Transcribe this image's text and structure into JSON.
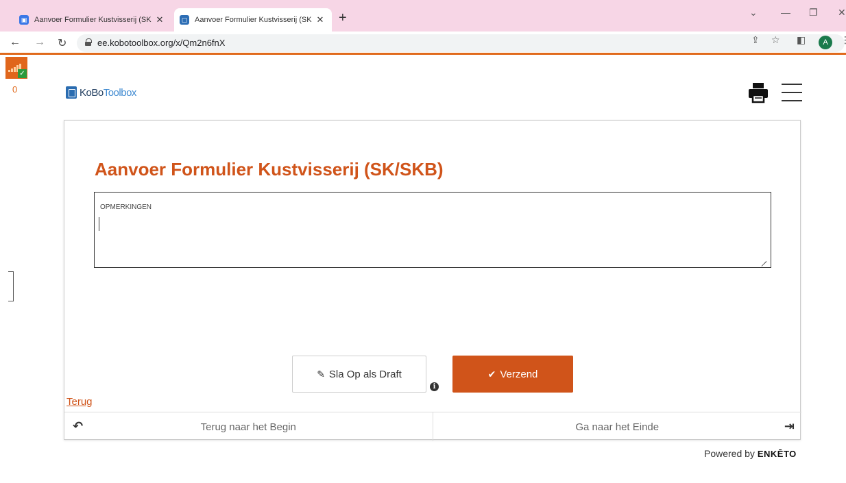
{
  "browser": {
    "tabs": [
      {
        "title": "Aanvoer Formulier Kustvisserij (SK",
        "close": "✕"
      },
      {
        "title": "Aanvoer Formulier Kustvisserij (SK",
        "close": "✕"
      }
    ],
    "new_tab": "+",
    "url": "ee.kobotoolbox.org/x/Qm2n6fnX",
    "avatar_letter": "A"
  },
  "sidebar": {
    "counter": "0"
  },
  "header": {
    "logo_ko": "KoBo",
    "logo_toolbox": "Toolbox"
  },
  "form": {
    "title": "Aanvoer Formulier Kustvisserij (SK/SKB)",
    "question_label": "OPMERKINGEN",
    "draft_button": "Sla Op als Draft",
    "submit_button": "Verzend",
    "back_link": "Terug",
    "nav_back": "Terug naar het Begin",
    "nav_end": "Ga naar het Einde"
  },
  "footer": {
    "powered_by": "Powered by",
    "brand": "ENKĒTO"
  },
  "colors": {
    "accent": "#d0541a",
    "tabbar": "#f7d6e6"
  }
}
